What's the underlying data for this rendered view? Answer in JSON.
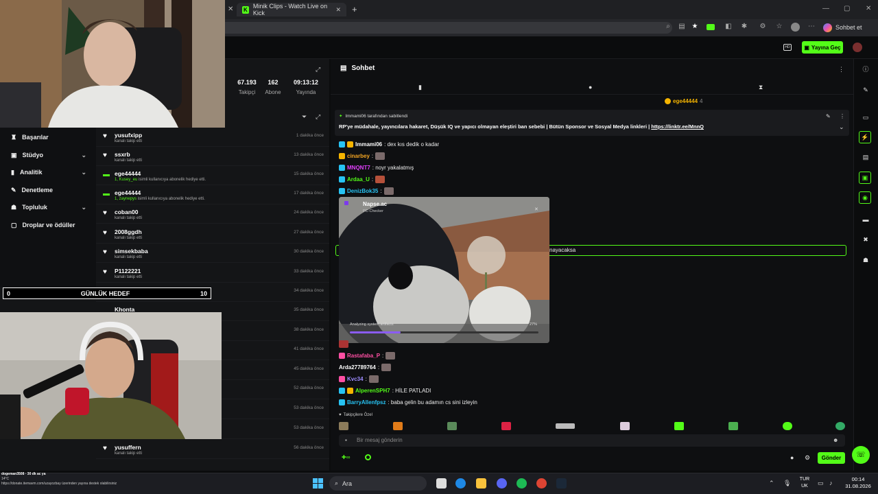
{
  "browser": {
    "tab_title": "Minik Clips - Watch Live on Kick",
    "profile_label": "Sohbet et"
  },
  "header": {
    "golive_label": "Yayına Geç"
  },
  "stats": [
    {
      "value": "67.193",
      "label": "Takipçi"
    },
    {
      "value": "162",
      "label": "Abone"
    },
    {
      "value": "09:13:12",
      "label": "Yayında"
    }
  ],
  "menu": [
    {
      "label": "Başarılar",
      "icon": "trophy-icon",
      "chevron": false
    },
    {
      "label": "Stüdyo",
      "icon": "camera-icon",
      "chevron": true
    },
    {
      "label": "Analitik",
      "icon": "chart-icon",
      "chevron": true
    },
    {
      "label": "Denetleme",
      "icon": "wrench-icon",
      "chevron": false
    },
    {
      "label": "Topluluk",
      "icon": "people-icon",
      "chevron": true
    },
    {
      "label": "Droplar ve ödüller",
      "icon": "gift-icon",
      "chevron": false
    }
  ],
  "activity": [
    {
      "name": "yusufxipp",
      "desc": "kanalı takip etti",
      "time": "1 dakika önce",
      "type": "follow"
    },
    {
      "name": "ssxrb",
      "desc": "kanalı takip etti",
      "time": "13 dakika önce",
      "type": "follow"
    },
    {
      "name": "ege44444",
      "gift": "1, Kusey_eu",
      "desc": " isimli kullanıcıya abonelik hediye etti.",
      "time": "15 dakika önce",
      "type": "sub"
    },
    {
      "name": "ege44444",
      "gift": "1, zaynepys",
      "desc": " isimli kullanıcıya abonelik hediye etti.",
      "time": "17 dakika önce",
      "type": "sub"
    },
    {
      "name": "coban00",
      "desc": "kanalı takip etti",
      "time": "24 dakika önce",
      "type": "follow"
    },
    {
      "name": "2008ggdh",
      "desc": "kanalı takip etti",
      "time": "27 dakika önce",
      "type": "follow"
    },
    {
      "name": "simsekbaba",
      "desc": "kanalı takip etti",
      "time": "30 dakika önce",
      "type": "follow"
    },
    {
      "name": "P1122221",
      "desc": "kanalı takip etti",
      "time": "33 dakika önce",
      "type": "follow"
    },
    {
      "name": "",
      "desc": "",
      "time": "34 dakika önce",
      "type": "follow"
    },
    {
      "name": "Khonta",
      "desc": "",
      "time": "35 dakika önce",
      "type": "follow"
    },
    {
      "name": "",
      "desc": "",
      "time": "38 dakika önce",
      "type": "follow"
    },
    {
      "name": "",
      "desc": "",
      "time": "41 dakika önce",
      "type": "follow"
    },
    {
      "name": "",
      "desc": "",
      "time": "45 dakika önce",
      "type": "follow"
    },
    {
      "name": "",
      "desc": "",
      "time": "52 dakika önce",
      "type": "follow"
    },
    {
      "name": "",
      "desc": "",
      "time": "53 dakika önce",
      "type": "follow"
    },
    {
      "name": "",
      "desc": "",
      "time": "53 dakika önce",
      "type": "follow"
    },
    {
      "name": "yusuffern",
      "desc": "kanalı takip etti",
      "time": "56 dakika önce",
      "type": "follow"
    }
  ],
  "goal": {
    "min": "0",
    "label": "GÜNLÜK HEDEF",
    "max": "10"
  },
  "chat": {
    "title": "Sohbet",
    "top_gifter": "ege44444",
    "top_gifter_count": "4",
    "pinned_by": "Immami06 tarafından sabitlendi",
    "pinned_text": "RP'ye müdahale, yayıncılara hakaret, Düşük IQ ve yapıcı olmayan eleştiri ban sebebi | Bütün Sponsor ve Sosyal Medya linkleri | ",
    "pinned_link": "https://linktr.ee/MnnQ",
    "highlight_tail": "nayacaksa",
    "messages": [
      {
        "user": "Immami06",
        "color": "#ffffff",
        "text": ": dex kıs dedik o kadar",
        "emote": false
      },
      {
        "user": "cinarbey",
        "color": "#f5a623",
        "text": ":",
        "emote": true
      },
      {
        "user": "MNQNT7",
        "color": "#e040fb",
        "text": ": noyr yakalatmış",
        "emote": false
      },
      {
        "user": "Ardaa_U",
        "color": "#53fc18",
        "text": ":",
        "emote": true
      },
      {
        "user": "DenizBok35",
        "color": "#27c3f3",
        "text": ":",
        "emote": true
      }
    ],
    "messages_bottom": [
      {
        "user": "Rastafaba_P",
        "color": "#ff4fa3",
        "text": ":",
        "emote": true
      },
      {
        "user": "Arda27789764",
        "color": "#ffffff",
        "text": ":",
        "emote": true
      },
      {
        "user": "Kvc34",
        "color": "#9d8cff",
        "text": ":",
        "emote": true
      },
      {
        "user": "AlperenSPH7",
        "color": "#53fc18",
        "text": ": HİLE PATLADI",
        "emote": false
      },
      {
        "user": "BarryAllenfpsz",
        "color": "#27c3f3",
        "text": ": baba gelin bu adamın cs sini izleyin",
        "emote": false
      }
    ],
    "followers_only": "Takipçilere Özel",
    "input_placeholder": "Bir mesaj gönderin",
    "send_label": "Gönder"
  },
  "popup": {
    "app_name": "Napse.ac",
    "app_sub": "PC-Checker",
    "status": "Analyzing system artifacts",
    "percent": "27%",
    "progress": 0.27
  },
  "taskbar": {
    "search_label": "Ara",
    "lang_top": "TUR",
    "lang_bottom": "UK",
    "time": "00:14",
    "date": "31.08.2026"
  },
  "overlay": {
    "notif_user": "dogeman3508 · 30 dk ac ya",
    "weather": "14°C",
    "donate_text": "https://donate.itemavm.com/uzayozbay üzerinden yayına destek olabilirsiniz"
  }
}
